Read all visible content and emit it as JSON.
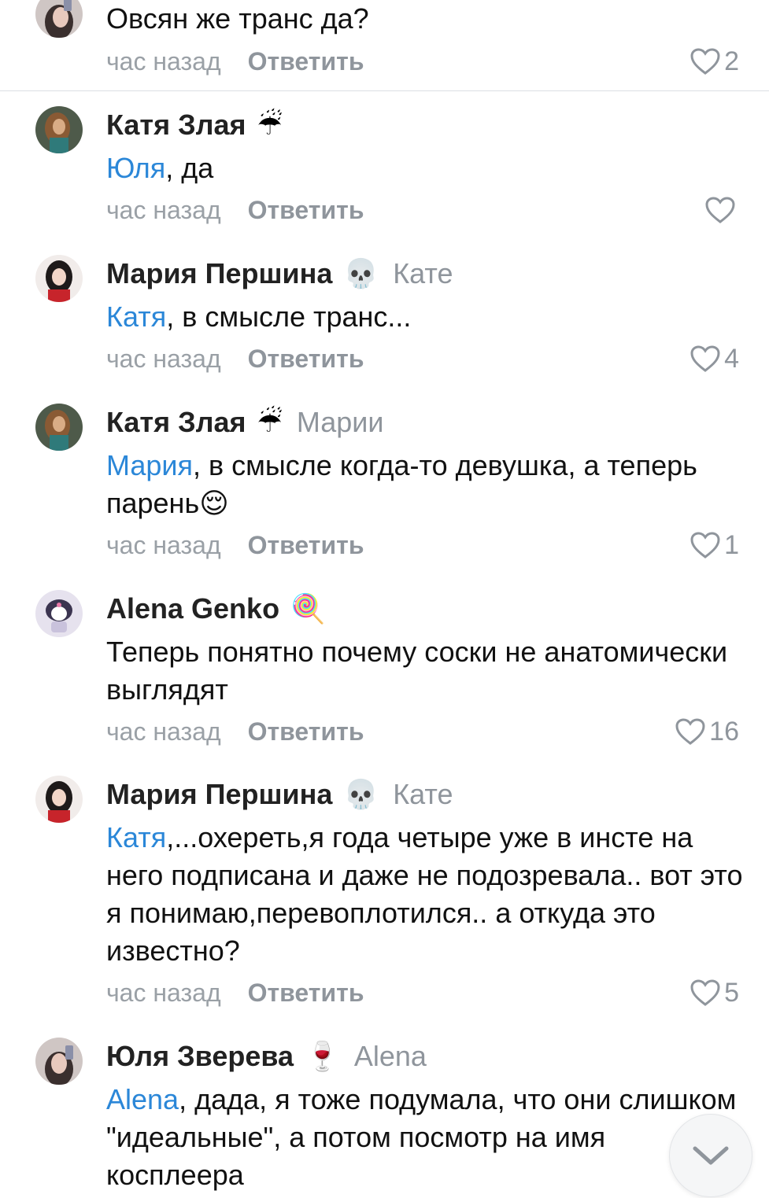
{
  "comments": [
    {
      "text": "Овсян же транс да?",
      "time": "час назад",
      "reply_label": "Ответить",
      "likes": "2"
    },
    {
      "author": "Катя Злая",
      "emoji": "☔",
      "mention": "Юля",
      "text": ", да",
      "time": "час назад",
      "reply_label": "Ответить",
      "likes": ""
    },
    {
      "author": "Мария Першина",
      "emoji": "💀",
      "reply_to": "Кате",
      "mention": "Катя",
      "text": ", в смысле транс...",
      "time": "час назад",
      "reply_label": "Ответить",
      "likes": "4"
    },
    {
      "author": "Катя Злая",
      "emoji": "☔",
      "reply_to": "Марии",
      "mention": "Мария",
      "text": ", в смысле когда-то девушка, а теперь парень😌",
      "time": "час назад",
      "reply_label": "Ответить",
      "likes": "1"
    },
    {
      "author": "Alena Genko",
      "emoji": "🍭",
      "text": "Теперь понятно почему соски не анатомически выглядят",
      "time": "час назад",
      "reply_label": "Ответить",
      "likes": "16"
    },
    {
      "author": "Мария Першина",
      "emoji": "💀",
      "reply_to": "Кате",
      "mention": "Катя",
      "text": ",...охереть,я года четыре уже в инсте на него подписана и даже не подозревала.. вот это я понимаю,перевоплотился.. а откуда это известно?",
      "time": "час назад",
      "reply_label": "Ответить",
      "likes": "5"
    },
    {
      "author": "Юля Зверева",
      "emoji": "🍷",
      "reply_to": "Alena",
      "mention": "Alena",
      "text": ", дада, я тоже подумала, что они слишком \"идеальные\", а потом посмотр на имя косплеера"
    }
  ],
  "colors": {
    "mention": "#2b87d8",
    "muted": "#8f959c",
    "divider": "#dcdfe3"
  },
  "scroll_button": {
    "icon": "chevron-down-icon"
  }
}
